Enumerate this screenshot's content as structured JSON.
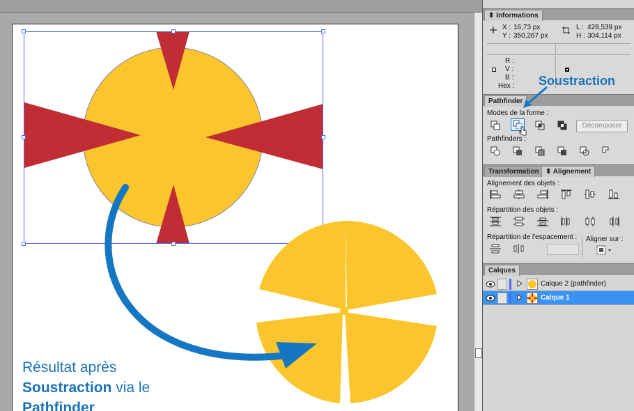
{
  "panels": {
    "informations": {
      "tab": "Informations",
      "x_label": "X :",
      "x_value": "16,73 px",
      "y_label": "Y :",
      "y_value": "350,267 px",
      "l_label": "L :",
      "l_value": "428,539 px",
      "h_label": "H :",
      "h_value": "304,114 px",
      "r_label": "R :",
      "v_label": "V :",
      "b_label": "B :",
      "hex_label": "Hex :"
    },
    "pathfinder": {
      "tab": "Pathfinder",
      "modes_label": "Modes de la forme :",
      "decompose_button": "Décomposer",
      "pathfinders_label": "Pathfinders :",
      "callout": "Soustraction"
    },
    "alignement": {
      "tabs": [
        "Transformation",
        "Alignement"
      ],
      "objects_label": "Alignement des objets :",
      "distribution_label": "Répartition des objets :",
      "spacing_label": "Répartition de l'espacement :",
      "align_to_label": "Aligner sur :"
    },
    "layers": {
      "tab": "Calques",
      "items": [
        {
          "name": "Calque 2 (pathfinder)",
          "selected": false
        },
        {
          "name": "Calque 1",
          "selected": true
        }
      ]
    }
  },
  "caption": {
    "line1": "Résultat après",
    "line2_bold": "Soustraction",
    "line2_rest": " via le",
    "line3_bold": "Pathfinder"
  },
  "colors": {
    "yellow": "#fbc62d",
    "red": "#c12d34",
    "arrow_blue": "#1577c2",
    "selection_blue": "#4f6df0",
    "layer_highlight": "#3a93f2"
  }
}
